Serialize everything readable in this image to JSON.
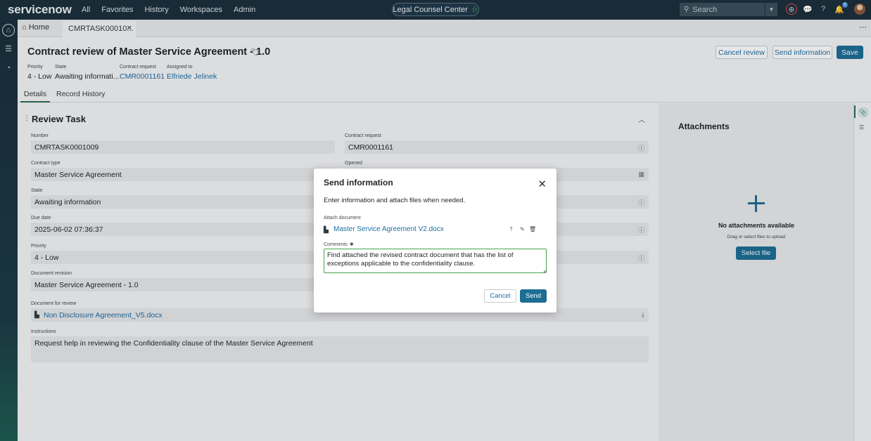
{
  "nav": {
    "logo": "servicenow",
    "menu": [
      "All",
      "Favorites",
      "History",
      "Workspaces",
      "Admin"
    ],
    "center_title": "Legal Counsel Center",
    "search_placeholder": "Search",
    "notification_count": "8"
  },
  "tabs": {
    "home": "Home",
    "active": "CMRTASK00010..."
  },
  "header": {
    "title": "Contract review of Master Service Agreement - 1.0",
    "buttons": {
      "cancel_review": "Cancel review",
      "send_information": "Send information",
      "save": "Save"
    },
    "meta": [
      {
        "label": "Priority",
        "value": "4 - Low"
      },
      {
        "label": "State",
        "value": "Awaiting informati..."
      },
      {
        "label": "Contract request",
        "value": "CMR0001161"
      },
      {
        "label": "Assigned to",
        "value": "Elfriede Jelinek"
      }
    ]
  },
  "subtabs": [
    "Details",
    "Record History"
  ],
  "form": {
    "section_title": "Review Task",
    "fields": {
      "number": {
        "label": "Number",
        "value": "CMRTASK0001009"
      },
      "contract_request": {
        "label": "Contract request",
        "value": "CMR0001161"
      },
      "contract_type": {
        "label": "Contract type",
        "value": "Master Service Agreement"
      },
      "opened": {
        "label": "Opened",
        "value": ""
      },
      "state": {
        "label": "State",
        "value": "Awaiting information"
      },
      "due_date": {
        "label": "Due date",
        "value": "2025-06-02 07:36:37"
      },
      "priority": {
        "label": "Priority",
        "value": "4 - Low"
      },
      "document_revision": {
        "label": "Document revision",
        "value": "Master Service Agreement - 1.0"
      },
      "document_for_review": {
        "label": "Document for review",
        "value": "Non Disclosure Agreement_V5.docx"
      },
      "instructions": {
        "label": "Instructions",
        "value": "Request help in reviewing the Confidentiality clause of the Master Service Agreement"
      }
    }
  },
  "attachments": {
    "title": "Attachments",
    "empty_title": "No attachments available",
    "empty_hint": "Drag or select files to upload",
    "select_button": "Select file"
  },
  "modal": {
    "title": "Send information",
    "description": "Enter information and attach files when needed.",
    "attach_label": "Attach document",
    "document_name": "Master Service Agreement V2.docx",
    "comments_label": "Comments",
    "comments_value": "Find attached the revised contract document that has the list of exceptions applicable to the confidentiality clause.",
    "cancel": "Cancel",
    "send": "Send"
  },
  "colors": {
    "nav_bg": "#1a2f3c",
    "primary_button": "#1d6e95",
    "link": "#1d6ea3",
    "logo_accent": "#62d84e",
    "focus_border": "#4aa34a"
  }
}
